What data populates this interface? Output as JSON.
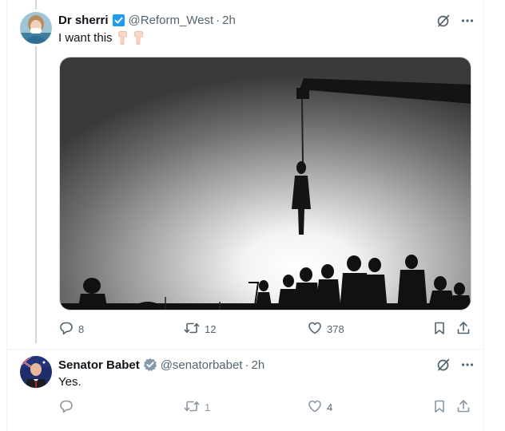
{
  "tweets": [
    {
      "name": "Dr sherri",
      "handle": "@Reform_West",
      "separator": "·",
      "time": "2h",
      "text": "I want this",
      "emoji": [
        "pointing-down-hand",
        "pointing-down-hand"
      ],
      "badge_color": "#1d9bf0",
      "actions": {
        "replies": "8",
        "retweets": "12",
        "likes": "378"
      }
    },
    {
      "name": "Senator Babet",
      "handle": "@senatorbabet",
      "separator": "·",
      "time": "2h",
      "text": "Yes.",
      "badge_color": "#829aab",
      "actions": {
        "replies": "",
        "retweets": "1",
        "likes": "4"
      }
    }
  ],
  "icons": [
    "grok-icon",
    "more-icon",
    "reply-icon",
    "retweet-icon",
    "like-icon",
    "bookmark-icon",
    "share-icon"
  ]
}
